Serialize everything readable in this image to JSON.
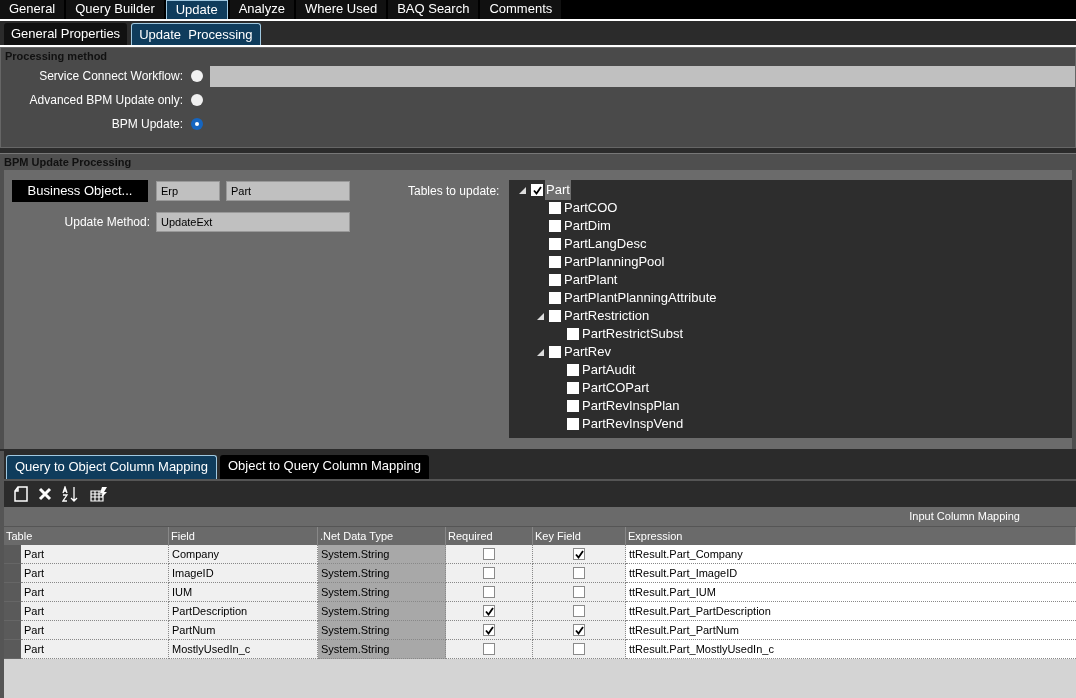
{
  "main_tabs": [
    {
      "label": "General",
      "selected": false
    },
    {
      "label": "Query Builder",
      "selected": false
    },
    {
      "label": "Update",
      "selected": true
    },
    {
      "label": "Analyze",
      "selected": false
    },
    {
      "label": "Where Used",
      "selected": false
    },
    {
      "label": "BAQ Search",
      "selected": false
    },
    {
      "label": "Comments",
      "selected": false
    }
  ],
  "sub_tabs": [
    {
      "label": "General Properties",
      "selected": false
    },
    {
      "label": "Update  Processing",
      "selected": true
    }
  ],
  "processing_method": {
    "title": "Processing method",
    "options": [
      {
        "label": "Service Connect Workflow:",
        "selected": false,
        "has_field": true
      },
      {
        "label": "Advanced BPM Update only:",
        "selected": false,
        "has_field": false
      },
      {
        "label": "BPM Update:",
        "selected": true,
        "has_field": false
      }
    ]
  },
  "bpm": {
    "title": "BPM Update Processing",
    "business_object_button": "Business Object...",
    "bo_fields": [
      "Erp",
      "Part"
    ],
    "update_method_label": "Update Method:",
    "update_method": "UpdateExt",
    "tables_label": "Tables to update:",
    "tree": [
      {
        "label": "Part",
        "checked": true,
        "selected": true,
        "expanded": true,
        "children": [
          {
            "label": "PartCOO",
            "checked": false,
            "selected": false
          },
          {
            "label": "PartDim",
            "checked": false,
            "selected": false
          },
          {
            "label": "PartLangDesc",
            "checked": false,
            "selected": false
          },
          {
            "label": "PartPlanningPool",
            "checked": false,
            "selected": false
          },
          {
            "label": "PartPlant",
            "checked": false,
            "selected": false
          },
          {
            "label": "PartPlantPlanningAttribute",
            "checked": false,
            "selected": false
          },
          {
            "label": "PartRestriction",
            "checked": false,
            "selected": false,
            "expanded": true,
            "children": [
              {
                "label": "PartRestrictSubst",
                "checked": false,
                "selected": false
              }
            ]
          },
          {
            "label": "PartRev",
            "checked": false,
            "selected": false,
            "expanded": true,
            "children": [
              {
                "label": "PartAudit",
                "checked": false,
                "selected": false
              },
              {
                "label": "PartCOPart",
                "checked": false,
                "selected": false
              },
              {
                "label": "PartRevInspPlan",
                "checked": false,
                "selected": false
              },
              {
                "label": "PartRevInspVend",
                "checked": false,
                "selected": false
              }
            ]
          }
        ]
      }
    ]
  },
  "mapping_tabs": [
    {
      "label": "Query to Object Column Mapping",
      "selected": true
    },
    {
      "label": "Object to Query Column Mapping",
      "selected": false
    }
  ],
  "grid": {
    "group_header": "Input Column Mapping",
    "columns": [
      "Table",
      "Field",
      ".Net Data Type",
      "Required",
      "Key Field",
      "Expression"
    ],
    "rows": [
      {
        "table": "Part",
        "field": "Company",
        "type": "System.String",
        "required": false,
        "key": true,
        "expression": "ttResult.Part_Company"
      },
      {
        "table": "Part",
        "field": "ImageID",
        "type": "System.String",
        "required": false,
        "key": false,
        "expression": "ttResult.Part_ImageID"
      },
      {
        "table": "Part",
        "field": "IUM",
        "type": "System.String",
        "required": false,
        "key": false,
        "expression": "ttResult.Part_IUM"
      },
      {
        "table": "Part",
        "field": "PartDescription",
        "type": "System.String",
        "required": true,
        "key": false,
        "expression": "ttResult.Part_PartDescription"
      },
      {
        "table": "Part",
        "field": "PartNum",
        "type": "System.String",
        "required": true,
        "key": true,
        "expression": "ttResult.Part_PartNum"
      },
      {
        "table": "Part",
        "field": "MostlyUsedIn_c",
        "type": "System.String",
        "required": false,
        "key": false,
        "expression": "ttResult.Part_MostlyUsedIn_c"
      }
    ]
  }
}
